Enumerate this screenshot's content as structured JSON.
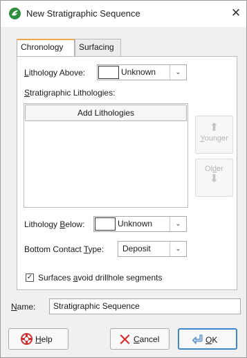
{
  "window": {
    "title": "New Stratigraphic Sequence",
    "close_glyph": "✕"
  },
  "tabs": [
    {
      "label": "Chronology",
      "active": true
    },
    {
      "label": "Surfacing",
      "active": false
    }
  ],
  "chronology": {
    "lithology_above": {
      "label_mn": "L",
      "label_rest": "ithology Above:",
      "value": "Unknown"
    },
    "stratigraphic_lithologies": {
      "label_mn": "S",
      "label_rest": "tratigraphic Lithologies:"
    },
    "add_lithologies": "Add Lithologies",
    "younger": {
      "label_mn": "Y",
      "label_rest": "ounger",
      "icon": "arrow-up-icon",
      "enabled": false
    },
    "older": {
      "label_pre": "Ol",
      "label_mn": "d",
      "label_rest": "er",
      "icon": "arrow-down-icon",
      "enabled": false
    },
    "lithology_below": {
      "label_pre": "Lithology ",
      "label_mn": "B",
      "label_rest": "elow:",
      "value": "Unknown"
    },
    "bottom_contact": {
      "label_pre": "Bottom Contact ",
      "label_mn": "T",
      "label_rest": "ype:",
      "value": "Deposit"
    },
    "avoid_drillholes": {
      "label_pre": "Surfaces ",
      "label_mn": "a",
      "label_rest": "void drillhole segments",
      "checked": true
    }
  },
  "name": {
    "label_mn": "N",
    "label_rest": "ame:",
    "value": "Stratigraphic Sequence"
  },
  "buttons": {
    "help": {
      "label_mn": "H",
      "label_rest": "elp",
      "icon": "help-icon"
    },
    "cancel": {
      "label_mn": "C",
      "label_rest": "ancel",
      "icon": "cancel-icon"
    },
    "ok": {
      "label_mn": "O",
      "label_rest": "K",
      "icon": "ok-icon"
    }
  },
  "colors": {
    "accent_tab": "#f0a64a",
    "ok_border": "#3c86d0",
    "app_icon": "#2e8f3e",
    "cancel_red": "#d62a2a"
  }
}
